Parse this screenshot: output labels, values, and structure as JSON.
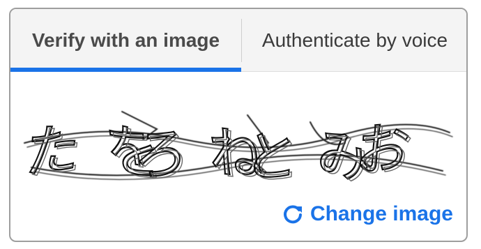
{
  "tabs": [
    {
      "label": "Verify with an image",
      "active": true
    },
    {
      "label": "Authenticate by voice",
      "active": false
    }
  ],
  "captcha": {
    "glyphs": [
      "た",
      "を",
      "ろ",
      "ね",
      "と",
      "み",
      "お"
    ]
  },
  "change_image": {
    "label": "Change image",
    "icon": "refresh-icon"
  },
  "colors": {
    "accent": "#1a73e8",
    "border": "#9e9e9e",
    "tab_background": "#f4f4f4"
  }
}
